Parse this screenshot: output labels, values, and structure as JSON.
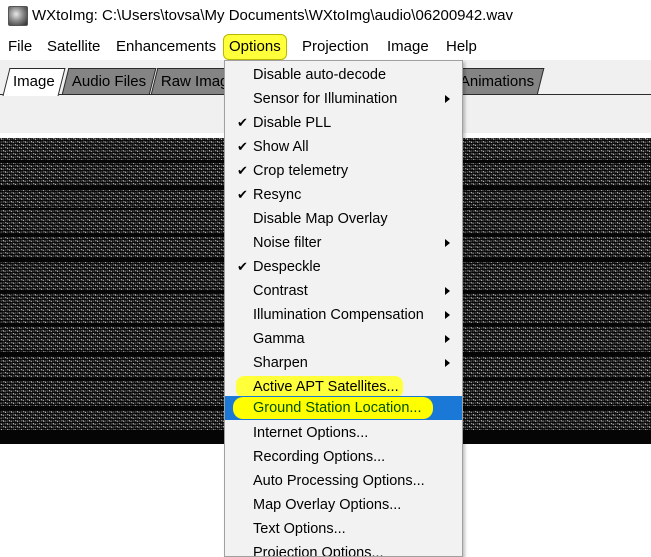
{
  "window": {
    "title": "WXtoImg: C:\\Users\\tovsa\\My Documents\\WXtoImg\\audio\\06200942.wav",
    "icon": "satellite-image-icon"
  },
  "menubar": {
    "items": [
      {
        "label": "File"
      },
      {
        "label": "Satellite"
      },
      {
        "label": "Enhancements"
      },
      {
        "label": "Options"
      },
      {
        "label": "Projection"
      },
      {
        "label": "Image"
      },
      {
        "label": "Help"
      }
    ],
    "highlight_color": "#ffff3a"
  },
  "tabs": [
    {
      "label": "Image"
    },
    {
      "label": "Audio Files"
    },
    {
      "label": "Raw Imag"
    },
    {
      "label": "Animations"
    }
  ],
  "options_menu": {
    "items": [
      {
        "label": "Disable auto-decode",
        "checked": false,
        "submenu": false
      },
      {
        "label": "Sensor for Illumination",
        "checked": false,
        "submenu": true
      },
      {
        "label": "Disable PLL",
        "checked": true,
        "submenu": false
      },
      {
        "label": "Show All",
        "checked": true,
        "submenu": false
      },
      {
        "label": "Crop telemetry",
        "checked": true,
        "submenu": false
      },
      {
        "label": "Resync",
        "checked": true,
        "submenu": false
      },
      {
        "label": "Disable Map Overlay",
        "checked": false,
        "submenu": false
      },
      {
        "label": "Noise filter",
        "checked": false,
        "submenu": true
      },
      {
        "label": "Despeckle",
        "checked": true,
        "submenu": false
      },
      {
        "label": "Contrast",
        "checked": false,
        "submenu": true
      },
      {
        "label": "Illumination Compensation",
        "checked": false,
        "submenu": true
      },
      {
        "label": "Gamma",
        "checked": false,
        "submenu": true
      },
      {
        "label": "Sharpen",
        "checked": false,
        "submenu": true
      },
      {
        "label": "Active APT Satellites...",
        "checked": false,
        "submenu": false
      },
      {
        "label": "Ground Station Location...",
        "checked": false,
        "submenu": false
      },
      {
        "label": "Internet Options...",
        "checked": false,
        "submenu": false
      },
      {
        "label": "Recording Options...",
        "checked": false,
        "submenu": false
      },
      {
        "label": "Auto Processing Options...",
        "checked": false,
        "submenu": false
      },
      {
        "label": "Map Overlay Options...",
        "checked": false,
        "submenu": false
      },
      {
        "label": "Text Options...",
        "checked": false,
        "submenu": false
      },
      {
        "label": "Projection Options...",
        "checked": false,
        "submenu": false
      }
    ],
    "check_glyph": "✔",
    "selected_item": "Ground Station Location...",
    "selection_color": "#1a78d6"
  }
}
